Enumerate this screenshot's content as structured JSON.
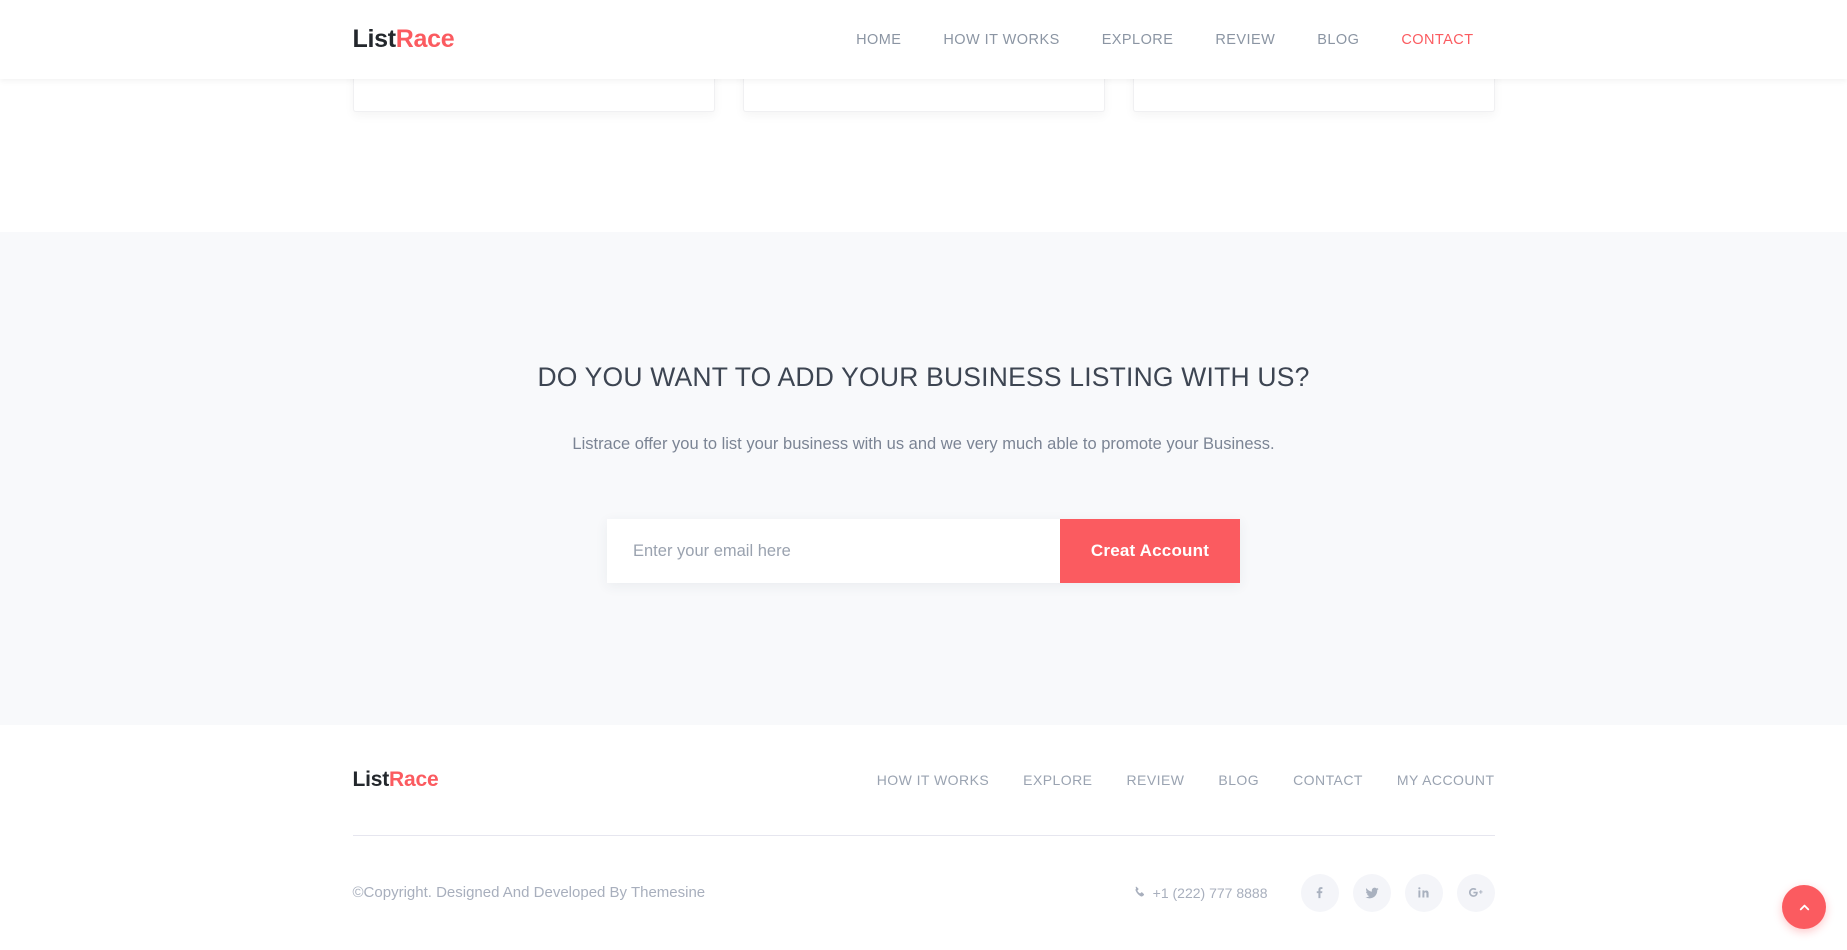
{
  "brand": {
    "first": "List",
    "second": "Race"
  },
  "header": {
    "nav": [
      {
        "label": "HOME",
        "active": false
      },
      {
        "label": "HOW IT WORKS",
        "active": false
      },
      {
        "label": "EXPLORE",
        "active": false
      },
      {
        "label": "REVIEW",
        "active": false
      },
      {
        "label": "BLOG",
        "active": false
      },
      {
        "label": "CONTACT",
        "active": true
      }
    ]
  },
  "cards": [
    {
      "name": "listing-card-1"
    },
    {
      "name": "listing-card-2"
    },
    {
      "name": "listing-card-3"
    }
  ],
  "cta": {
    "title": "DO YOU WANT TO ADD YOUR BUSINESS LISTING WITH US?",
    "subtitle": "Listrace offer you to list your business with us and we very much able to promote your Business.",
    "email_placeholder": "Enter your email here",
    "email_value": "",
    "button_label": "Creat Account"
  },
  "footer": {
    "nav": [
      {
        "label": "HOW IT WORKS"
      },
      {
        "label": "EXPLORE"
      },
      {
        "label": "REVIEW"
      },
      {
        "label": "BLOG"
      },
      {
        "label": "CONTACT"
      },
      {
        "label": "MY ACCOUNT"
      }
    ],
    "copyright": "©Copyright. Designed And Developed By Themesine",
    "phone": "+1 (222) 777 8888",
    "socials": [
      {
        "name": "facebook-icon"
      },
      {
        "name": "twitter-icon"
      },
      {
        "name": "linkedin-icon"
      },
      {
        "name": "google-plus-icon"
      }
    ]
  },
  "colors": {
    "accent": "#fb5b60",
    "heading": "#3d4552",
    "body_text": "#7b8494",
    "nav_text": "#8b95a3",
    "section_bg": "#f8f9fb",
    "page_bg": "#ffffff",
    "divider": "#e6e6ef",
    "social_bg": "#f4f5f9"
  }
}
